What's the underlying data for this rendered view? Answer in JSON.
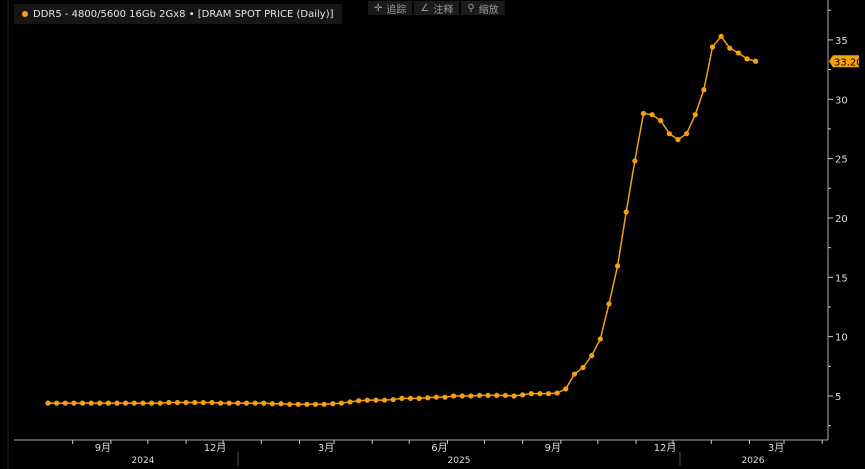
{
  "toolbar": {
    "track": "追踪",
    "annotate": "注释",
    "zoom": "缩放",
    "track_icon": "crosshair-icon",
    "annotate_icon": "pen-icon",
    "zoom_icon": "magnifier-icon"
  },
  "chart_data": {
    "type": "line",
    "title": "DDR5 - 4800/5600 16Gb 2Gx8 • [DRAM SPOT PRICE (Daily)]",
    "legend_position": "top-left",
    "x_start": "2024-07-12",
    "x_step_days": 7,
    "values": [
      4.4,
      4.4,
      4.4,
      4.4,
      4.4,
      4.4,
      4.4,
      4.4,
      4.4,
      4.4,
      4.4,
      4.4,
      4.4,
      4.4,
      4.45,
      4.45,
      4.45,
      4.45,
      4.45,
      4.45,
      4.4,
      4.4,
      4.4,
      4.4,
      4.4,
      4.4,
      4.35,
      4.35,
      4.3,
      4.3,
      4.3,
      4.3,
      4.3,
      4.35,
      4.4,
      4.5,
      4.6,
      4.65,
      4.65,
      4.65,
      4.7,
      4.8,
      4.8,
      4.8,
      4.85,
      4.9,
      4.9,
      5.0,
      5.0,
      5.0,
      5.05,
      5.05,
      5.05,
      5.05,
      5.0,
      5.1,
      5.2,
      5.2,
      5.2,
      5.25,
      5.6,
      6.85,
      7.4,
      8.4,
      9.8,
      12.75,
      15.95,
      20.5,
      24.8,
      28.8,
      28.7,
      28.2,
      27.1,
      26.6,
      27.1,
      28.7,
      30.8,
      34.4,
      35.3,
      34.3,
      33.9,
      33.4,
      33.2
    ],
    "last_value_label": "33.20",
    "ylim": [
      0,
      38
    ],
    "y_ticks": [
      5,
      10,
      15,
      20,
      25,
      30,
      35
    ],
    "x_tick_labels": [
      "9月",
      "12月",
      "3月",
      "6月",
      "9月",
      "12月",
      "3月"
    ],
    "year_labels": [
      "2024",
      "2025",
      "2026"
    ],
    "series_color": "#f5a00f",
    "grid": false
  }
}
